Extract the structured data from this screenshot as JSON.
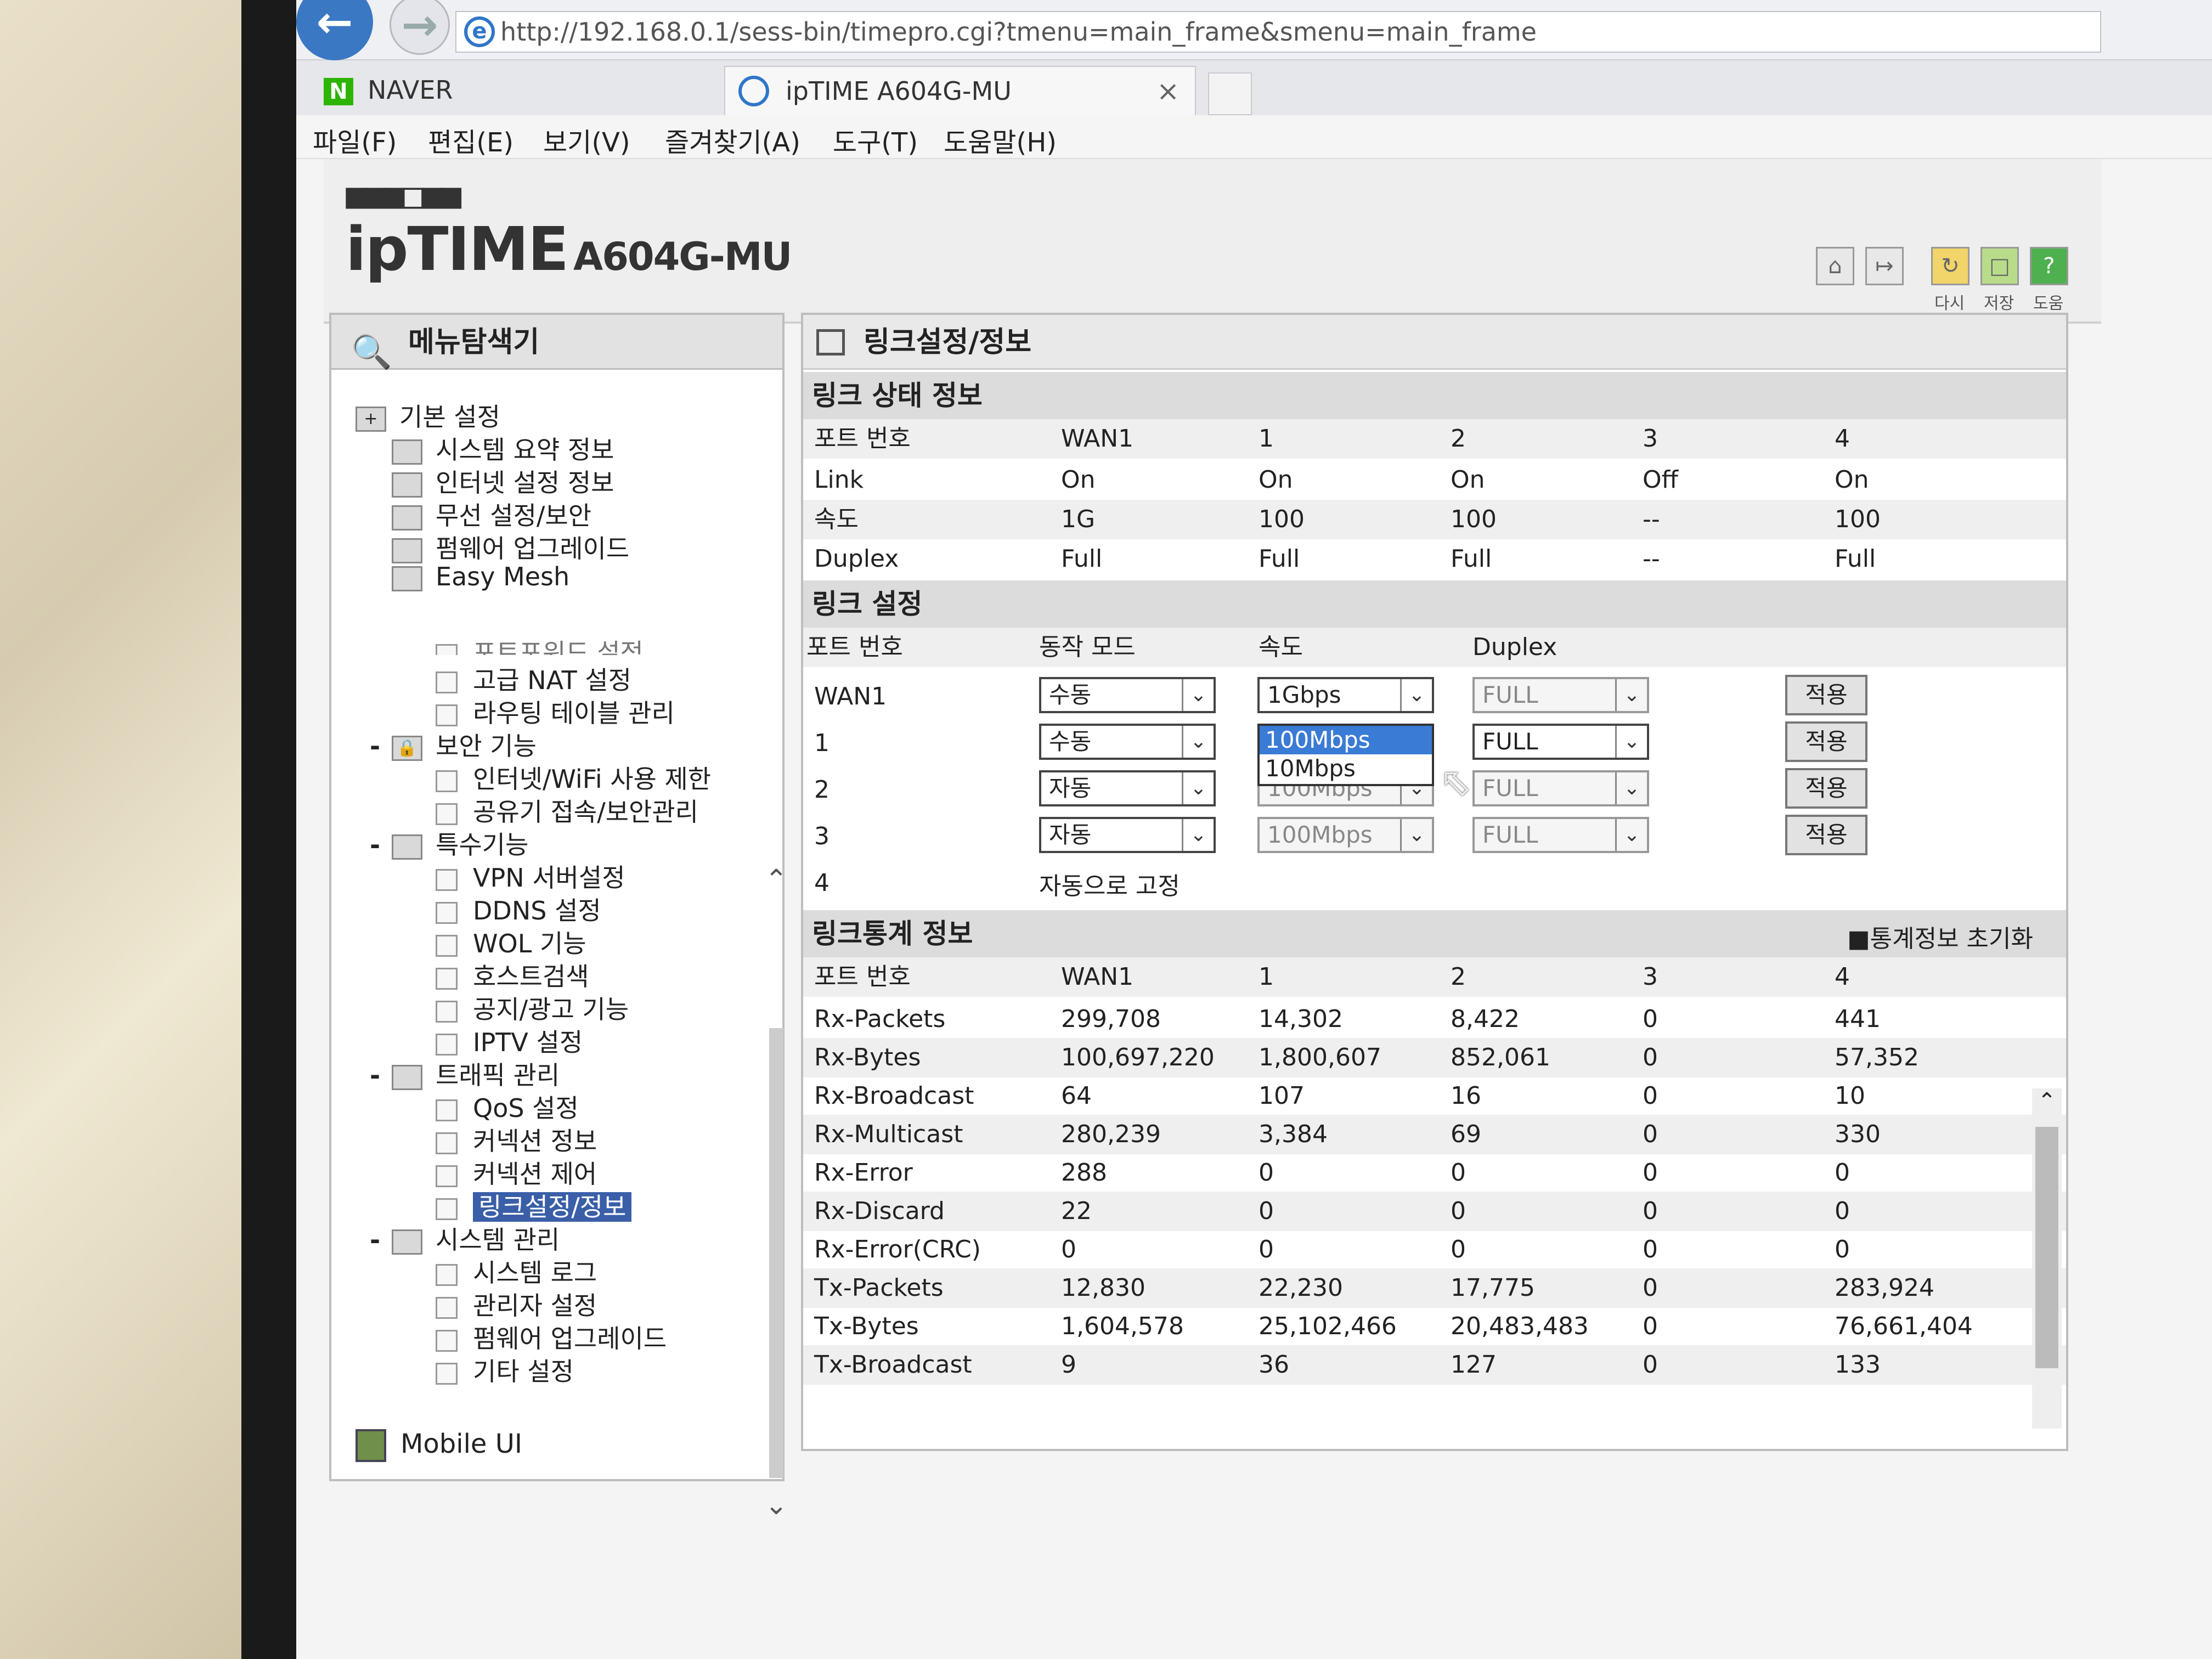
{
  "browser": {
    "url": "http://192.168.0.1/sess-bin/timepro.cgi?tmenu=main_frame&smenu=main_frame",
    "tabs": [
      {
        "label": "NAVER"
      },
      {
        "label": "ipTIME A604G-MU"
      }
    ],
    "menu": [
      "파일(F)",
      "편집(E)",
      "보기(V)",
      "즐겨찾기(A)",
      "도구(T)",
      "도움말(H)"
    ]
  },
  "router": {
    "logo_dots": "■■■□■■",
    "brand": "ipTIME",
    "model": "A604G-MU",
    "header_buttons": [
      {
        "label": "다시",
        "icon": "refresh-icon"
      },
      {
        "label": "저장",
        "icon": "save-icon"
      },
      {
        "label": "도움",
        "icon": "help-icon"
      }
    ]
  },
  "sidebar": {
    "title": "메뉴탐색기",
    "basic_group": "기본 설정",
    "basic_items": [
      "시스템 요약 정보",
      "인터넷 설정 정보",
      "무선 설정/보안",
      "펌웨어 업그레이드",
      "Easy Mesh"
    ],
    "cut_item": "포트포워드 설정",
    "adv_items": [
      "고급 NAT 설정",
      "라우팅 테이블 관리"
    ],
    "security_group": "보안 기능",
    "security_items": [
      "인터넷/WiFi 사용 제한",
      "공유기 접속/보안관리"
    ],
    "special_group": "특수기능",
    "special_items": [
      "VPN 서버설정",
      "DDNS 설정",
      "WOL 기능",
      "호스트검색",
      "공지/광고 기능",
      "IPTV 설정"
    ],
    "traffic_group": "트래픽 관리",
    "traffic_items": [
      "QoS 설정",
      "커넥션 정보",
      "커넥션 제어",
      "링크설정/정보"
    ],
    "system_group": "시스템 관리",
    "system_items": [
      "시스템 로그",
      "관리자 설정",
      "펌웨어 업그레이드",
      "기타 설정"
    ],
    "mobile": "Mobile UI"
  },
  "main": {
    "title": "링크설정/정보",
    "status_title": "링크 상태 정보",
    "status_headers": [
      "포트 번호",
      "WAN1",
      "1",
      "2",
      "3",
      "4"
    ],
    "status_rows": [
      [
        "Link",
        "On",
        "On",
        "On",
        "Off",
        "On"
      ],
      [
        "속도",
        "1G",
        "100",
        "100",
        "--",
        "100"
      ],
      [
        "Duplex",
        "Full",
        "Full",
        "Full",
        "--",
        "Full"
      ]
    ],
    "config_title": "링크 설정",
    "config_headers": [
      "포트 번호",
      "동작 모드",
      "속도",
      "Duplex"
    ],
    "config_rows": [
      {
        "port": "WAN1",
        "mode": "수동",
        "speed": "1Gbps",
        "duplex": "FULL",
        "apply": "적용"
      },
      {
        "port": "1",
        "mode": "수동",
        "speed": "100Mbps",
        "duplex": "FULL",
        "apply": "적용"
      },
      {
        "port": "2",
        "mode": "자동",
        "speed": "100Mbps",
        "duplex": "FULL",
        "apply": "적용"
      },
      {
        "port": "3",
        "mode": "자동",
        "speed": "100Mbps",
        "duplex": "FULL",
        "apply": "적용"
      }
    ],
    "port4": {
      "port": "4",
      "note": "자동으로 고정"
    },
    "dropdown_options": [
      "100Mbps",
      "10Mbps"
    ],
    "stats_title": "링크통계 정보",
    "stats_reset": "통계정보 초기화",
    "stats_headers": [
      "포트 번호",
      "WAN1",
      "1",
      "2",
      "3",
      "4"
    ],
    "stats_rows": [
      [
        "Rx-Packets",
        "299,708",
        "14,302",
        "8,422",
        "0",
        "441"
      ],
      [
        "Rx-Bytes",
        "100,697,220",
        "1,800,607",
        "852,061",
        "0",
        "57,352"
      ],
      [
        "Rx-Broadcast",
        "64",
        "107",
        "16",
        "0",
        "10"
      ],
      [
        "Rx-Multicast",
        "280,239",
        "3,384",
        "69",
        "0",
        "330"
      ],
      [
        "Rx-Error",
        "288",
        "0",
        "0",
        "0",
        "0"
      ],
      [
        "Rx-Discard",
        "22",
        "0",
        "0",
        "0",
        "0"
      ],
      [
        "Rx-Error(CRC)",
        "0",
        "0",
        "0",
        "0",
        "0"
      ],
      [
        "Tx-Packets",
        "12,830",
        "22,230",
        "17,775",
        "0",
        "283,924"
      ],
      [
        "Tx-Bytes",
        "1,604,578",
        "25,102,466",
        "20,483,483",
        "0",
        "76,661,404"
      ],
      [
        "Tx-Broadcast",
        "9",
        "36",
        "127",
        "0",
        "133"
      ]
    ]
  }
}
